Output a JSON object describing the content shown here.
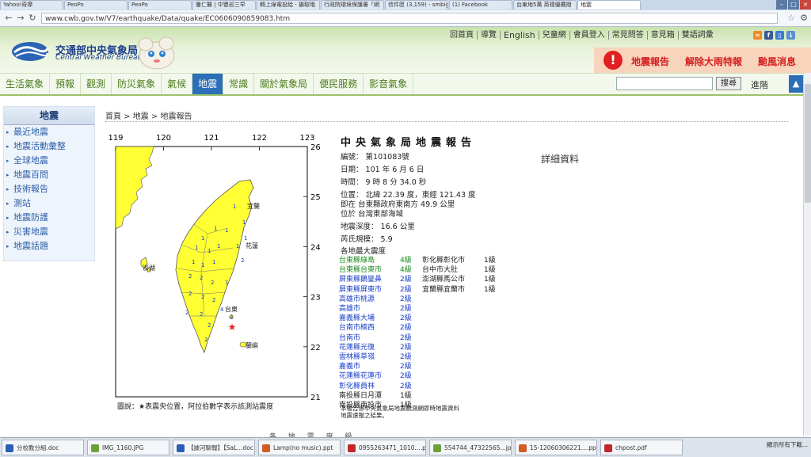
{
  "browser": {
    "tabs": [
      "Yahoo!奇摩",
      "PeoPo",
      "PeoPo",
      "屢仁醫 | 中豐巡三早",
      "轉上綠電投給 - 攝取哦",
      "行政院環境保護署「網",
      "信件匣 (3,159) - smbig",
      "(1) Facebook",
      "台東地5萬 英樣優攤撥",
      "地震"
    ],
    "url": "www.cwb.gov.tw/V7/earthquake/Data/quake/EC0606090859083.htm"
  },
  "header": {
    "logo_cn": "交通部中央氣象局",
    "logo_en": "Central Weather Bureau",
    "top_links": [
      "回首頁",
      "導覽",
      "English",
      "兒童網",
      "會員登入",
      "常見問答",
      "意見箱",
      "雙語詞彙"
    ],
    "alerts": [
      "地震報告",
      "解除大雨特報",
      "颱風消息"
    ],
    "alert_icon": "!"
  },
  "nav": {
    "items": [
      "生活氣象",
      "預報",
      "觀測",
      "防災氣象",
      "氣候",
      "地震",
      "常識",
      "關於氣象局",
      "便民服務",
      "影音氣象"
    ],
    "active_index": 5,
    "search_button": "搜尋",
    "advanced": "進階"
  },
  "sidebar": {
    "title": "地震",
    "items": [
      "最近地震",
      "地震活動彙整",
      "全球地震",
      "地震百問",
      "技術報告",
      "測站",
      "地震防護",
      "災害地震",
      "地震話題"
    ]
  },
  "breadcrumb": "首頁 > 地震 > 地震報告",
  "map": {
    "lon_ticks": [
      "119",
      "120",
      "121",
      "122",
      "123"
    ],
    "lat_ticks": [
      "26",
      "25",
      "24",
      "23",
      "22",
      "21"
    ],
    "labels": [
      "宜蘭",
      "花蓮",
      "台東",
      "澎湖",
      "蘭嶼"
    ],
    "epicenter": {
      "lon": 121.43,
      "lat": 22.39
    },
    "caption": "圖說：★表震央位置，阿拉伯數字表示該測站震度"
  },
  "report": {
    "title": "中央氣象局地震報告",
    "number": "編號： 第101083號",
    "date": "日期： 101 年 6 月 6 日",
    "time": "時間： 9 時 8 分 34.0 秒",
    "position": "位置： 北緯 22.39 度，東經 121.43 度",
    "location_1": "即在 台東縣政府東南方 49.9 公里",
    "location_2": "位於 台灣東部海域",
    "depth": "地震深度： 16.6 公里",
    "magnitude": "芮氏規模： 5.9",
    "intensity_heading": "各地最大震度",
    "detail_link": "詳細資料",
    "col1": [
      {
        "place": "台東縣綠島",
        "level": "4級"
      },
      {
        "place": "台東縣台東市",
        "level": "4級"
      },
      {
        "place": "屏東縣鵝鑾鼻",
        "level": "2級"
      },
      {
        "place": "屏東縣屏東市",
        "level": "2級"
      },
      {
        "place": "高雄市桃源",
        "level": "2級"
      },
      {
        "place": "高雄市",
        "level": "2級"
      },
      {
        "place": "嘉義縣大埔",
        "level": "2級"
      },
      {
        "place": "台南市楠西",
        "level": "2級"
      },
      {
        "place": "台南市",
        "level": "2級"
      },
      {
        "place": "花蓮縣光復",
        "level": "2級"
      },
      {
        "place": "雲林縣草嶺",
        "level": "2級"
      },
      {
        "place": "嘉義市",
        "level": "2級"
      },
      {
        "place": "花蓮縣花蓮市",
        "level": "2級"
      },
      {
        "place": "彰化縣員林",
        "level": "2級"
      },
      {
        "place": "南投縣日月潭",
        "level": "1級"
      },
      {
        "place": "南投縣南投市",
        "level": "1級"
      }
    ],
    "col2": [
      {
        "place": "彰化縣彰化市",
        "level": "1級"
      },
      {
        "place": "台中市大肚",
        "level": "1級"
      },
      {
        "place": "澎湖縣馬公市",
        "level": "1級"
      },
      {
        "place": "宜蘭縣宜蘭市",
        "level": "1級"
      }
    ],
    "note_1": "本報告係中央氣象局地震觀測網即時地震資料",
    "note_2": "地震速報之結果。",
    "more": "各 地 震 度 級"
  },
  "taskbar": {
    "items": [
      "分校教分組.doc",
      "IMG_1160.JPG",
      "【據河聊報】【SaL...doc",
      "Lamp(no music).ppt",
      "0955263471_1010....pdf",
      "554744_47322565...jpg",
      "15-12060306221....pptx",
      "chpost.pdf"
    ],
    "show_all": "顯示所有下載..."
  },
  "colors": {
    "land": "#ffff33",
    "sea": "#ffffff",
    "nav_active": "#2c6fb7",
    "alert_text": "#d42020",
    "intensity_green": "#1a8a1a",
    "intensity_blue": "#1a3fc8",
    "epicenter": "#e02020"
  }
}
